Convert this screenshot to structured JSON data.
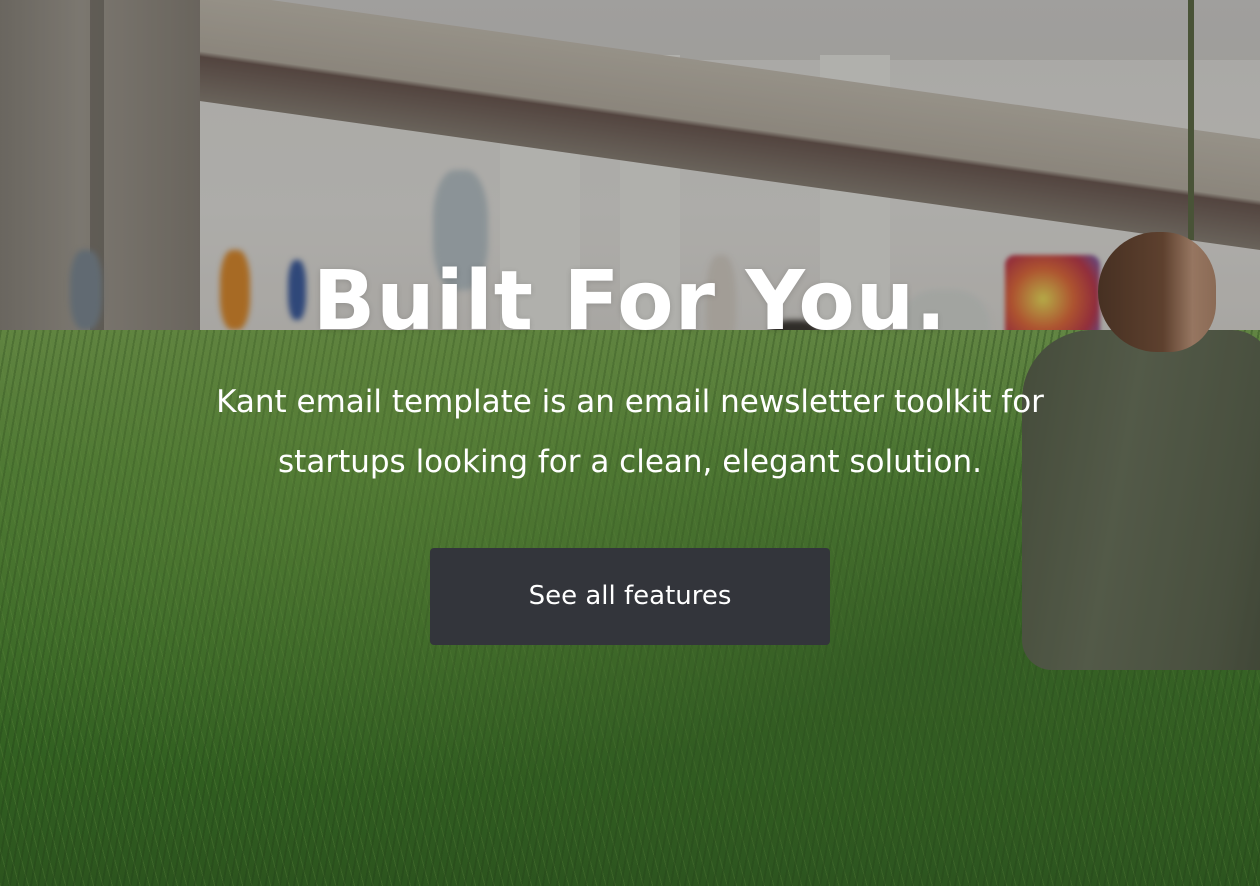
{
  "hero": {
    "headline": "Built For You.",
    "subtitle": "Kant email template is an email newsletter toolkit for startups looking for a clean, elegant solution.",
    "cta_label": "See all features"
  },
  "colors": {
    "button_bg": "#33353b",
    "text": "#ffffff"
  }
}
